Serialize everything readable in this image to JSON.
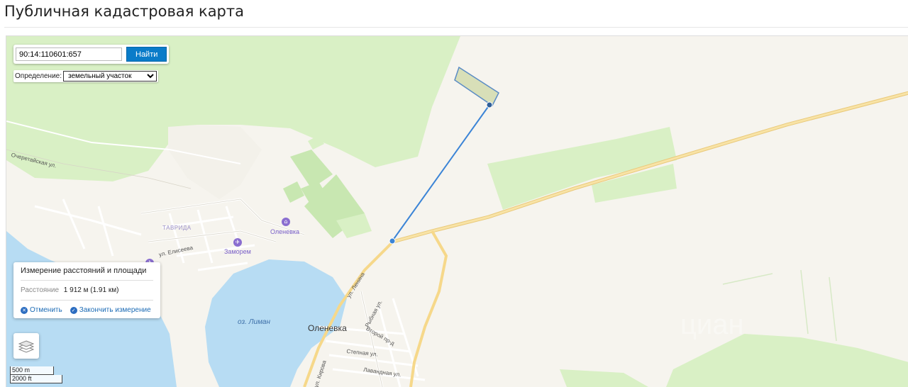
{
  "page": {
    "title": "Публичная кадастровая карта"
  },
  "search": {
    "value": "90:14:110601:657",
    "button_label": "Найти"
  },
  "definition": {
    "label": "Определение:",
    "selected": "земельный участок"
  },
  "measure": {
    "title": "Измерение расстояний и площади",
    "distance_label": "Расстояние",
    "distance_value": "1 912 м (1.91 км)",
    "cancel_label": "Отменить",
    "finish_label": "Закончить измерение"
  },
  "scale": {
    "metric": "500 m",
    "imperial": "2000 ft"
  },
  "map": {
    "labels": {
      "ocheretayskaya": "Очеретайская ул.",
      "tavrida": "ТАВРИДА",
      "olenevka_poi": "Оленевка",
      "zamorem": "Заморем",
      "eliseeva": "ул. Елисеева",
      "liman": "оз. Лиман",
      "olenevka_town": "Оленевка",
      "lenina": "ул. Ленина",
      "rybnaya": "Рыбная ул.",
      "vtoroy": "Второй пр-д",
      "stepnaya": "Степная ул.",
      "lavandnaya": "Лавандная ул.",
      "kirova": "ул. Кирова"
    }
  },
  "colors": {
    "accent": "#0a7cc9",
    "water": "#b7dcf3",
    "vegetation": "#d9f0c5",
    "road": "#f6d88a",
    "measure_line": "#3b84d6",
    "parcel_fill": "#d8dfb8",
    "parcel_stroke": "#5b8cc5"
  },
  "icons": {
    "cancel": "close-circle-icon",
    "finish": "check-circle-icon",
    "layers": "layers-icon",
    "poi": "place-marker-icon"
  }
}
